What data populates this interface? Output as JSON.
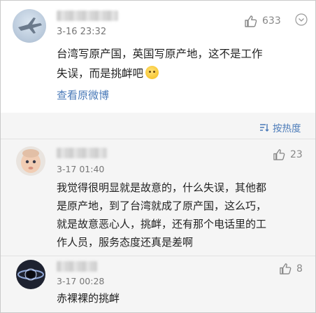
{
  "post": {
    "time": "3-16 23:32",
    "like_count": "633",
    "content_line1": "台湾写原产国，英国写原产地，这不是工作",
    "content_line2": "失误，而是挑衅吧",
    "view_original": "查看原微博"
  },
  "sort": {
    "label": "按热度"
  },
  "comments": [
    {
      "time": "3-17 01:40",
      "like_count": "23",
      "lines": [
        "我觉得很明显就是故意的，什么失误，其他都",
        "是原产地，到了台湾就成了原产国，这么巧，",
        "就是故意恶心人，挑衅，还有那个电话里的工",
        "作人员，服务态度还真是差啊"
      ]
    },
    {
      "time": "3-17 00:28",
      "like_count": "8",
      "lines": [
        "赤裸裸的挑衅"
      ]
    }
  ],
  "colors": {
    "link": "#4a7ab8",
    "text": "#222222",
    "meta": "#777777",
    "bg": "#f5f5f5"
  },
  "icons": [
    "thumb-up-icon",
    "more-chevron-icon",
    "sort-icon",
    "emoji-icon"
  ]
}
